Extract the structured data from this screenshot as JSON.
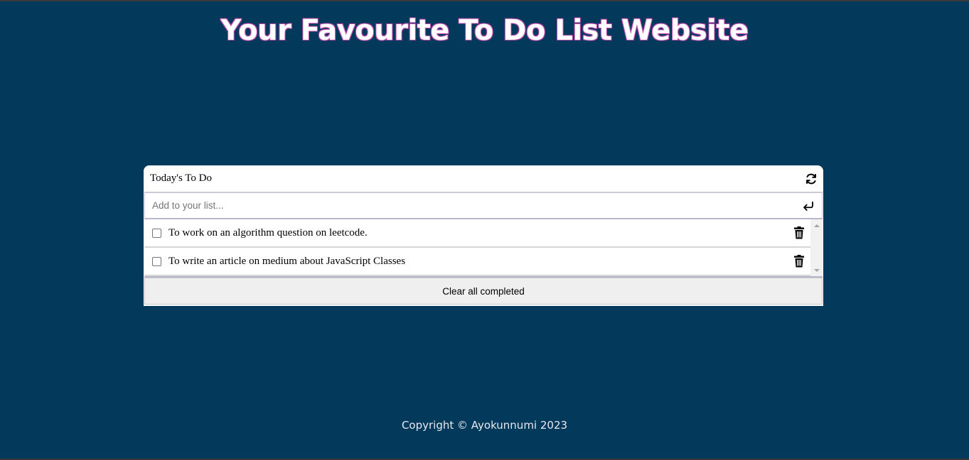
{
  "page": {
    "title": "Your Favourite To Do List Website",
    "footer": "Copyright © Ayokunnumi 2023"
  },
  "card": {
    "title": "Today's To Do",
    "refresh_icon": "refresh-icon",
    "add_placeholder": "Add to your list...",
    "enter_icon": "enter-icon",
    "items": [
      {
        "text": "To work on an algorithm question on leetcode.",
        "completed": false,
        "icon": "trash-icon"
      },
      {
        "text": "To write an article on medium about JavaScript Classes",
        "completed": false,
        "icon": "trash-icon"
      }
    ],
    "clear_label": "Clear all completed"
  },
  "colors": {
    "background": "#033a5c",
    "title_outline": "#c34bb0",
    "card": "#ffffff",
    "clear_button": "#efefef"
  }
}
